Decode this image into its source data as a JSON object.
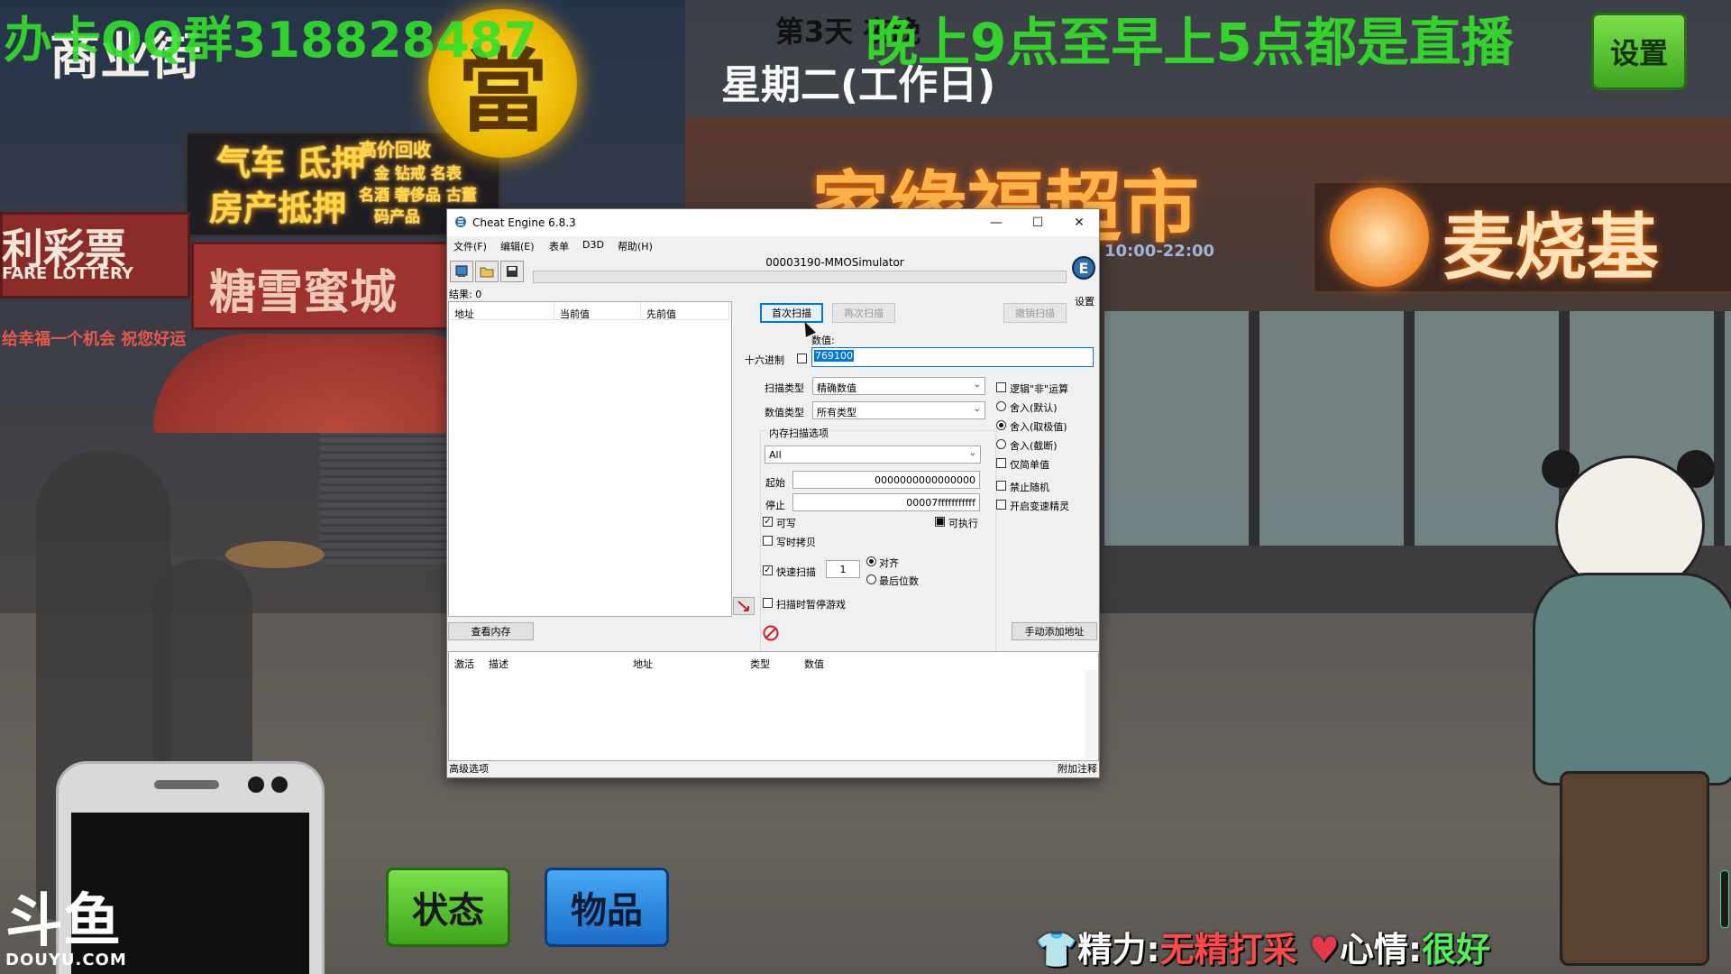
{
  "game": {
    "street_name": "商业街",
    "qq_banner": "办卡QQ群318828487",
    "day": "第3天 夜晚",
    "weekday": "星期二(工作日)",
    "live_banner": "晚上9点至早上5点都是直播",
    "settings_label": "设置",
    "status_button": "状态",
    "items_button": "物品",
    "stats": {
      "energy_label": "精力:",
      "energy_value": "无精打采",
      "mood_label": "心情:",
      "mood_value": "很好"
    },
    "douyu_big": "斗鱼",
    "douyu_small": "DOUYU.COM"
  },
  "signs": {
    "pawn_logo": "當",
    "pawn_line1": "气车 氐押",
    "pawn_line2": "房产抵押",
    "pawn_recycle": "高价回收",
    "pawn_items1": "金 钻戒 名表",
    "pawn_items2": "名酒 奢侈品 古董",
    "pawn_items3": "码产品",
    "lottery": "利彩票",
    "lottery_en": "FARE LOTTERY",
    "tangxue": "糖雪蜜城",
    "slogan": "给幸福一个机会  祝您好运",
    "supermarket": "家缘福超市",
    "hours": "10:00-22:00",
    "maishaoji": "麦烧基"
  },
  "ce": {
    "title": "Cheat Engine 6.8.3",
    "menu": [
      "文件(F)",
      "编辑(E)",
      "表单",
      "D3D",
      "帮助(H)"
    ],
    "process": "00003190-MMOSimulator",
    "settings_label": "设置",
    "results": "结果: 0",
    "columns": [
      "地址",
      "当前值",
      "先前值"
    ],
    "first_scan": "首次扫描",
    "next_scan": "再次扫描",
    "undo_scan": "撤销扫描",
    "value_label": "数值:",
    "hex_label": "十六进制",
    "value": "769100",
    "scan_type_label": "扫描类型",
    "scan_type": "精确数值",
    "value_type_label": "数值类型",
    "value_type": "所有类型",
    "mem_options_label": "内存扫描选项",
    "mem_region": "All",
    "start_label": "起始",
    "start_value": "0000000000000000",
    "stop_label": "停止",
    "stop_value": "00007fffffffffff",
    "writable_label": "可写",
    "executable_label": "可执行",
    "copy_on_write_label": "写时拷贝",
    "fast_scan_label": "快速扫描",
    "fast_scan_value": "1",
    "align_label": "对齐",
    "last_digits_label": "最后位数",
    "pause_label": "扫描时暂停游戏",
    "right_options": [
      "逻辑\"非\"运算",
      "舍入(默认)",
      "舍入(取极值)",
      "舍入(截断)",
      "仅简单值",
      "禁止随机",
      "开启变速精灵"
    ],
    "view_memory": "查看内存",
    "add_address": "手动添加地址",
    "addr_columns": [
      "激活",
      "描述",
      "地址",
      "类型",
      "数值"
    ],
    "advanced": "高级选项",
    "comments": "附加注释"
  }
}
